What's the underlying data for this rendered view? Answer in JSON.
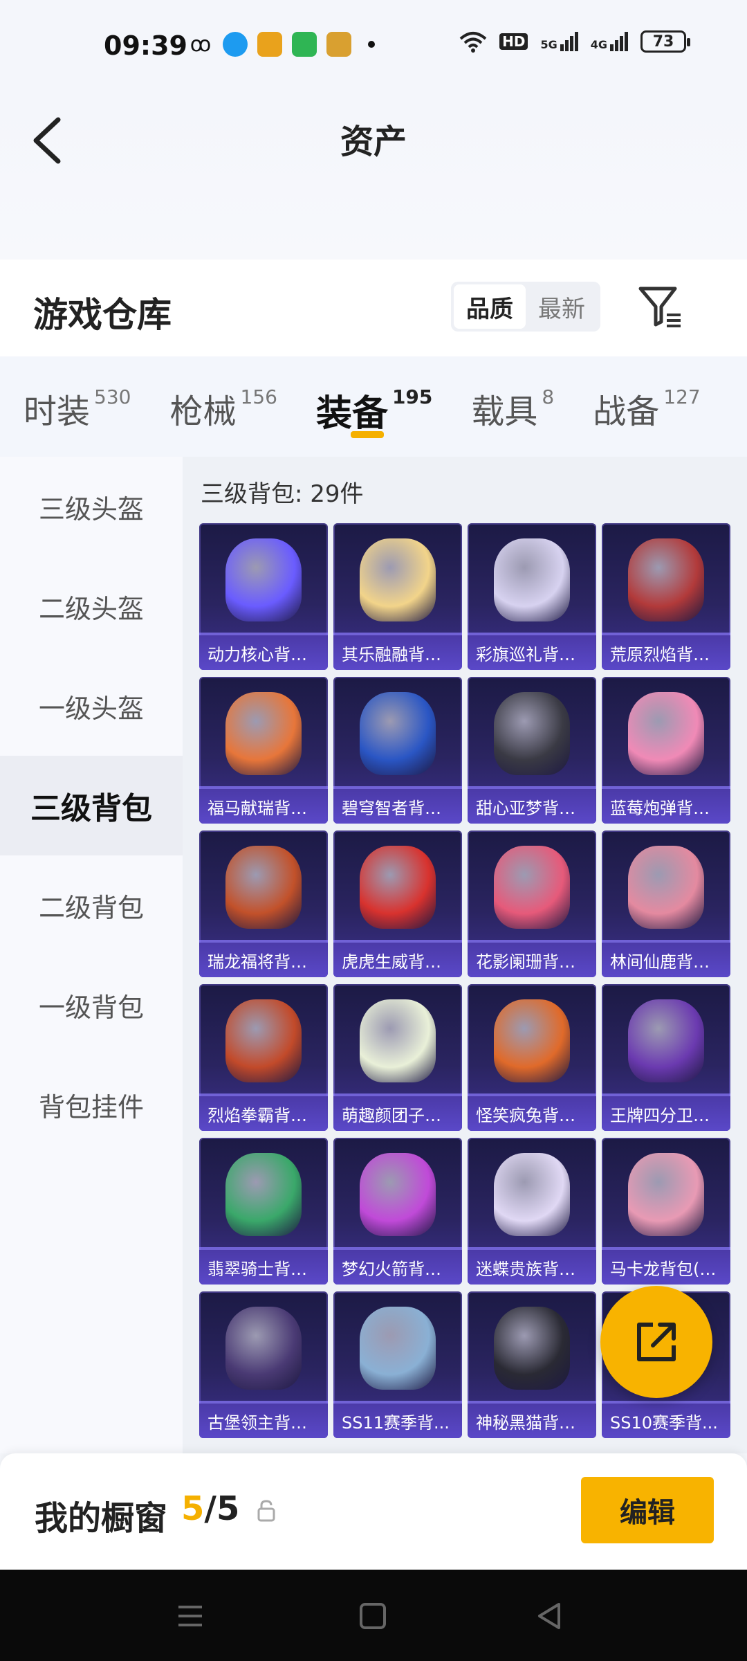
{
  "status_bar": {
    "time": "09:39",
    "hd_label": "HD",
    "net1": "5G",
    "net2": "4G",
    "battery": "73"
  },
  "nav": {
    "title": "资产"
  },
  "warehouse": {
    "title": "游戏仓库",
    "sort_options": [
      "品质",
      "最新"
    ],
    "sort_active": 0
  },
  "tabs": [
    {
      "label": "时装",
      "count": "530"
    },
    {
      "label": "枪械",
      "count": "156"
    },
    {
      "label": "装备",
      "count": "195"
    },
    {
      "label": "载具",
      "count": "8"
    },
    {
      "label": "战备",
      "count": "127"
    }
  ],
  "tab_active": 2,
  "sidebar": {
    "items": [
      "三级头盔",
      "二级头盔",
      "一级头盔",
      "三级背包",
      "二级背包",
      "一级背包",
      "背包挂件"
    ],
    "active": 3
  },
  "section": {
    "title": "三级背包: 29件"
  },
  "items": [
    {
      "name": "动力核心背包...",
      "color": "#6a5cff"
    },
    {
      "name": "其乐融融背包...",
      "color": "#f2d48a"
    },
    {
      "name": "彩旗巡礼背包...",
      "color": "#d7d2f0"
    },
    {
      "name": "荒原烈焰背包...",
      "color": "#b23a3a"
    },
    {
      "name": "福马献瑞背包...",
      "color": "#e7763a"
    },
    {
      "name": "碧穹智者背包...",
      "color": "#2a56c4"
    },
    {
      "name": "甜心亚梦背包...",
      "color": "#3a3a44"
    },
    {
      "name": "蓝莓炮弹背包...",
      "color": "#f08ab6"
    },
    {
      "name": "瑞龙福将背包...",
      "color": "#c2512a"
    },
    {
      "name": "虎虎生威背包...",
      "color": "#d8322e"
    },
    {
      "name": "花影阑珊背包...",
      "color": "#e65a7a"
    },
    {
      "name": "林间仙鹿背包...",
      "color": "#e48aa0"
    },
    {
      "name": "烈焰拳霸背包...",
      "color": "#c24a2a"
    },
    {
      "name": "萌趣颜团子背...",
      "color": "#e9f0d8"
    },
    {
      "name": "怪笑疯兔背包...",
      "color": "#e06a2a"
    },
    {
      "name": "王牌四分卫背...",
      "color": "#6b3ab0"
    },
    {
      "name": "翡翠骑士背包...",
      "color": "#3aa86a"
    },
    {
      "name": "梦幻火箭背包...",
      "color": "#c04ad8"
    },
    {
      "name": "迷蝶贵族背包...",
      "color": "#e0d8f4"
    },
    {
      "name": "马卡龙背包(3...",
      "color": "#e89ab4"
    },
    {
      "name": "古堡领主背包...",
      "color": "#4a3a74"
    },
    {
      "name": "SS11赛季背...",
      "color": "#8ab0d4"
    },
    {
      "name": "神秘黑猫背包...",
      "color": "#2a2a34"
    },
    {
      "name": "SS10赛季背...",
      "color": "#5a4a8a"
    }
  ],
  "showcase": {
    "title": "我的橱窗",
    "current": "5",
    "separator": "/",
    "total": "5",
    "edit_label": "编辑"
  }
}
